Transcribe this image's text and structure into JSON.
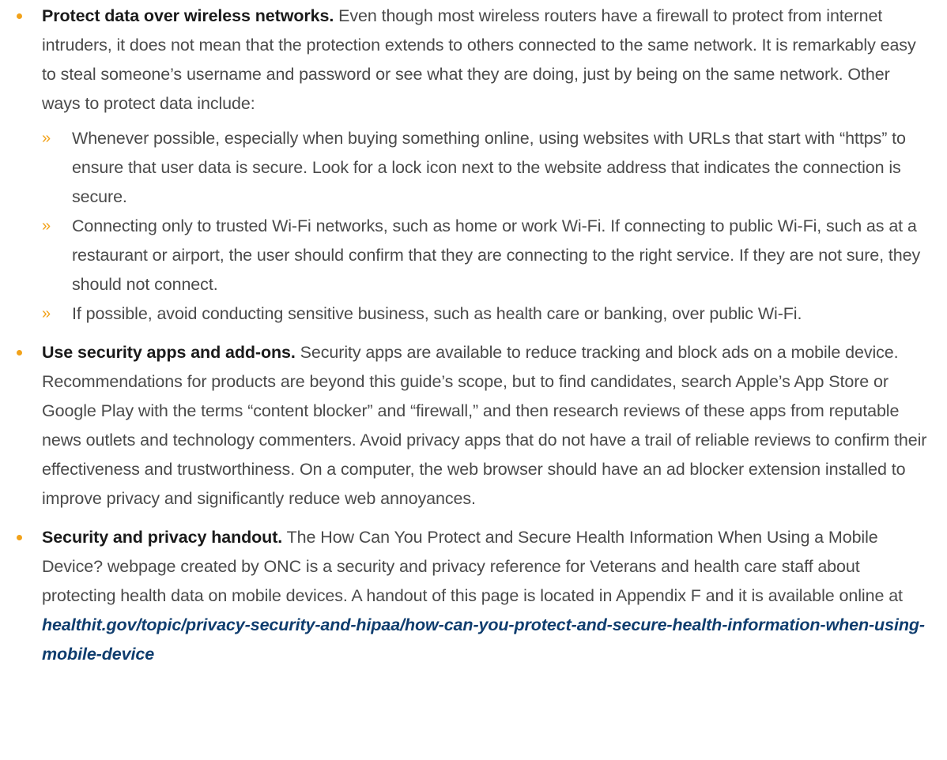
{
  "colors": {
    "accent": "#f2a21a",
    "link": "#0f3d6e",
    "lead_text": "#1a1a1a",
    "body_text": "#4a4a4a"
  },
  "icons": {
    "bullet": "bullet-dot-icon",
    "sub_bullet": "double-chevron-icon"
  },
  "sub_marker": "»",
  "items": [
    {
      "lead": "Protect data over wireless networks.",
      "text": " Even though most wireless routers have a firewall to protect from internet intruders, it does not mean that the protection extends to others connected to the same network. It is remarkably easy to steal someone’s username and password or see what they are doing, just by being on the same network. Other ways to protect data include:",
      "sub_items": [
        "Whenever possible, especially when buying something online, using websites with URLs that start with “https” to ensure that user data is secure. Look for a lock icon next to the website address that indicates the connection is secure.",
        "Connecting only to trusted Wi-Fi networks, such as home or work Wi-Fi. If connecting to public Wi-Fi, such as at a restaurant or airport, the user should confirm that they are connecting to the right service. If they are not sure, they should not connect.",
        "If possible, avoid conducting sensitive business, such as health care or banking, over public Wi-Fi."
      ]
    },
    {
      "lead": "Use security apps and add-ons.",
      "text": " Security apps are available to reduce tracking and block ads on a mobile device. Recommendations for products are beyond this guide’s scope, but to find candidates, search Apple’s App Store or Google Play with the terms “content blocker” and “firewall,” and then research reviews of these apps from reputable news outlets and technology commenters. Avoid privacy apps that do not have a trail of reliable reviews to confirm their effectiveness and trustworthiness. On a computer, the web browser should have an ad blocker extension installed to improve privacy and significantly reduce web annoyances."
    },
    {
      "lead": "Security and privacy handout.",
      "text": " The How Can You Protect and Secure Health Information When Using a Mobile Device? webpage created by ONC is a security and privacy reference for Veterans and health care staff about protecting health data on mobile devices. A handout of this page is located in Appendix F and it is available online at ",
      "link": "healthit.gov/topic/privacy-security-and-hipaa/how-can-you-protect-and-secure-health-information-when-using-mobile-device"
    }
  ]
}
